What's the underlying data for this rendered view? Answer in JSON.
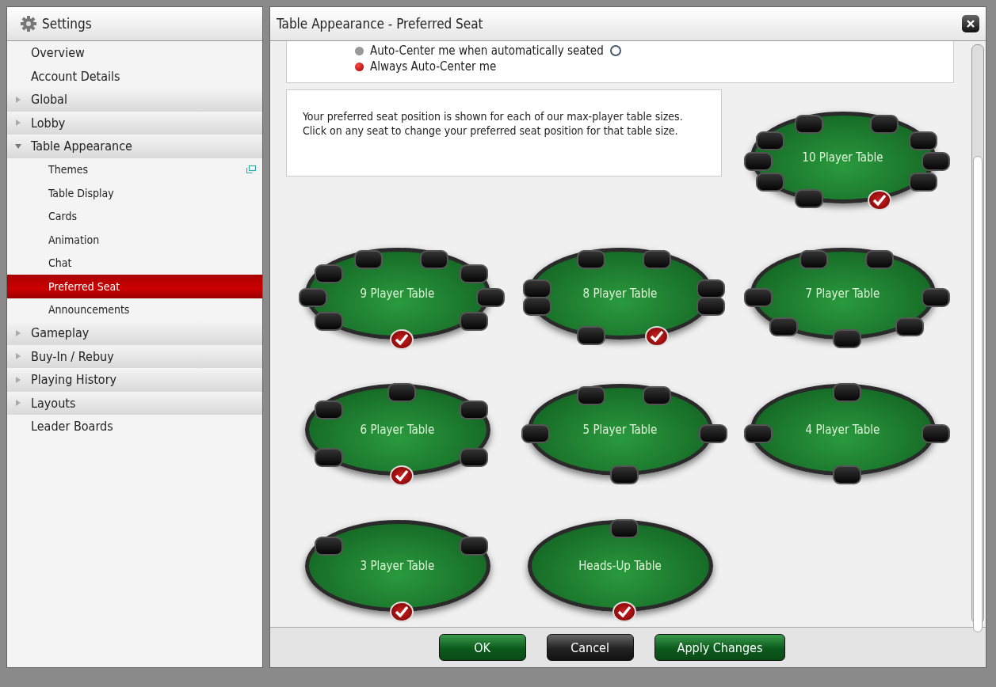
{
  "sidebar": {
    "title": "Settings",
    "items": [
      {
        "label": "Overview",
        "kind": "link",
        "selected": false
      },
      {
        "label": "Account Details",
        "kind": "link",
        "selected": false
      },
      {
        "label": "Global",
        "kind": "group",
        "expanded": false,
        "selected": false
      },
      {
        "label": "Lobby",
        "kind": "group",
        "expanded": false,
        "selected": false
      },
      {
        "label": "Table Appearance",
        "kind": "group",
        "expanded": true,
        "selected": false,
        "children": [
          {
            "label": "Themes",
            "selected": false,
            "popout": true
          },
          {
            "label": "Table Display",
            "selected": false
          },
          {
            "label": "Cards",
            "selected": false
          },
          {
            "label": "Animation",
            "selected": false
          },
          {
            "label": "Chat",
            "selected": false
          },
          {
            "label": "Preferred Seat",
            "selected": true
          },
          {
            "label": "Announcements",
            "selected": false
          }
        ]
      },
      {
        "label": "Gameplay",
        "kind": "group",
        "expanded": false,
        "selected": false
      },
      {
        "label": "Buy-In / Rebuy",
        "kind": "group",
        "expanded": false,
        "selected": false
      },
      {
        "label": "Playing History",
        "kind": "group",
        "expanded": false,
        "selected": false
      },
      {
        "label": "Layouts",
        "kind": "group",
        "expanded": false,
        "selected": false
      },
      {
        "label": "Leader Boards",
        "kind": "link",
        "selected": false
      }
    ]
  },
  "panel": {
    "title": "Table Appearance - Preferred Seat",
    "options": [
      {
        "label": "Auto-Center me when automatically seated",
        "selected": false,
        "help": true
      },
      {
        "label": "Always Auto-Center me",
        "selected": true,
        "help": false
      }
    ],
    "info": "Your preferred seat position is shown for each of our max-player table sizes. Click on any seat to change your preferred seat position for that table size.",
    "tables": [
      {
        "label": "10 Player Table",
        "seats": [
          {
            "selected": false
          },
          {
            "selected": false
          },
          {
            "selected": false
          },
          {
            "selected": false
          },
          {
            "selected": false
          },
          {
            "selected": true
          },
          {
            "selected": false
          },
          {
            "selected": false
          },
          {
            "selected": false
          },
          {
            "selected": false
          }
        ]
      },
      {
        "label": "9 Player Table",
        "seats": [
          {
            "selected": false
          },
          {
            "selected": false
          },
          {
            "selected": false
          },
          {
            "selected": false
          },
          {
            "selected": false
          },
          {
            "selected": true
          },
          {
            "selected": false
          },
          {
            "selected": false
          },
          {
            "selected": false
          }
        ]
      },
      {
        "label": "8 Player Table",
        "seats": [
          {
            "selected": false
          },
          {
            "selected": false
          },
          {
            "selected": false
          },
          {
            "selected": false
          },
          {
            "selected": true
          },
          {
            "selected": false
          },
          {
            "selected": false
          },
          {
            "selected": false
          }
        ]
      },
      {
        "label": "7 Player Table",
        "seats": [
          {
            "selected": false
          },
          {
            "selected": false
          },
          {
            "selected": false
          },
          {
            "selected": false
          },
          {
            "selected": false
          },
          {
            "selected": false
          },
          {
            "selected": false
          }
        ]
      },
      {
        "label": "6 Player Table",
        "seats": [
          {
            "selected": false
          },
          {
            "selected": false
          },
          {
            "selected": false
          },
          {
            "selected": true
          },
          {
            "selected": false
          },
          {
            "selected": false
          }
        ]
      },
      {
        "label": "5 Player Table",
        "seats": [
          {
            "selected": false
          },
          {
            "selected": false
          },
          {
            "selected": false
          },
          {
            "selected": false
          },
          {
            "selected": false
          }
        ]
      },
      {
        "label": "4 Player Table",
        "seats": [
          {
            "selected": false
          },
          {
            "selected": false
          },
          {
            "selected": false
          },
          {
            "selected": false
          }
        ]
      },
      {
        "label": "3 Player Table",
        "seats": [
          {
            "selected": false
          },
          {
            "selected": false
          },
          {
            "selected": true
          }
        ]
      },
      {
        "label": "Heads-Up Table",
        "seats": [
          {
            "selected": false
          },
          {
            "selected": true
          }
        ]
      }
    ]
  },
  "buttons": [
    {
      "label": "OK",
      "kind": "primary"
    },
    {
      "label": "Cancel",
      "kind": "secondary"
    },
    {
      "label": "Apply Changes",
      "kind": "primary"
    }
  ]
}
